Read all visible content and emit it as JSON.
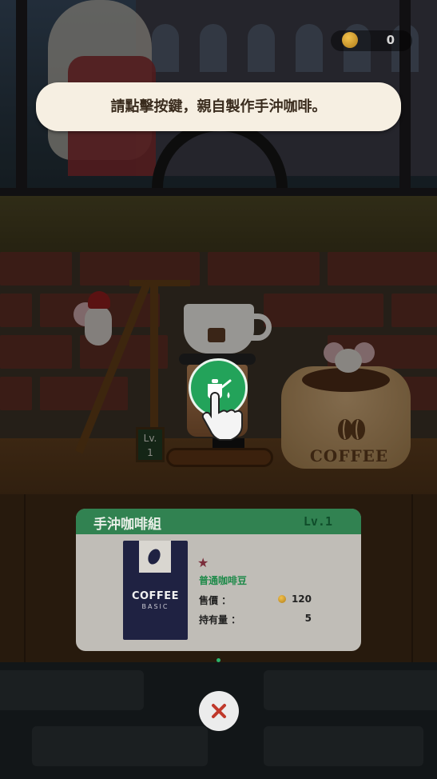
{
  "hud": {
    "coin_count": "0"
  },
  "tip": {
    "text": "請點擊按鍵，親自製作手沖咖啡。"
  },
  "stand": {
    "level_sign": "Lv.\n1"
  },
  "bag": {
    "label": "COFFEE"
  },
  "card": {
    "title": "手沖咖啡組",
    "level": "Lv.1",
    "product_name": "COFFEE",
    "product_sub": "BASIC",
    "star": "★",
    "bean_name": "普通咖啡豆",
    "price_label": "售價 ：",
    "price_value": "120",
    "owned_label": "持有量 ：",
    "owned_value": "5"
  },
  "colors": {
    "accent_green": "#23a35a",
    "card_header": "#187840",
    "tip_bg": "#f6efe2",
    "close_x": "#c0392b"
  },
  "icons": {
    "action": "kettle-pour-icon",
    "hint": "tap-hand-icon",
    "currency": "coin-icon",
    "close": "close-icon"
  }
}
